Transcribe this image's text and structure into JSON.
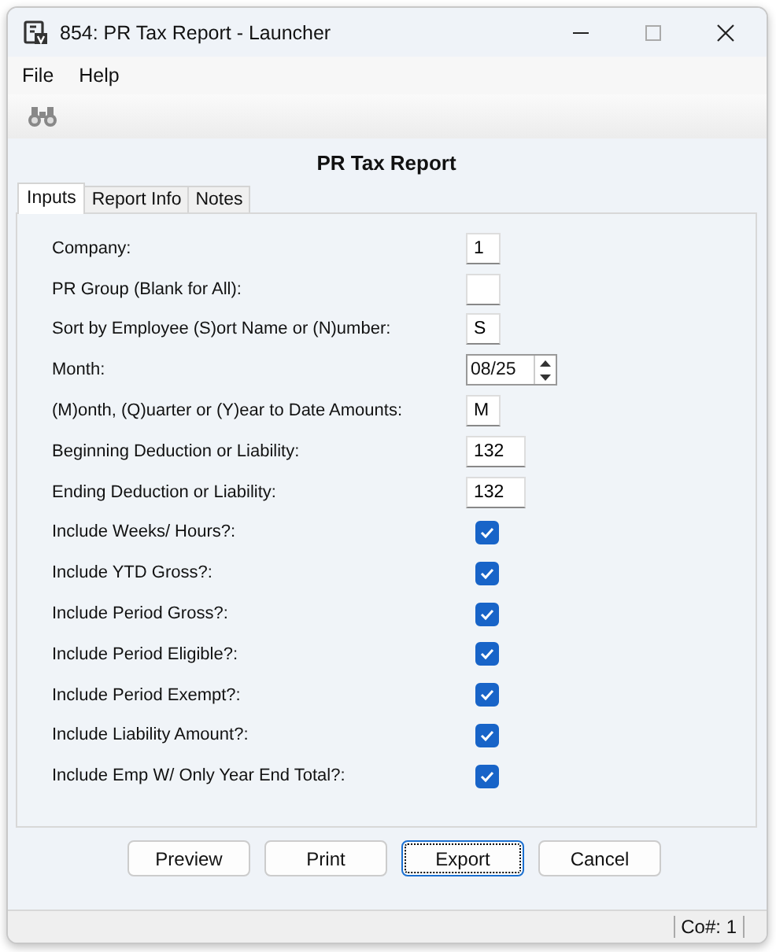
{
  "window": {
    "title": "854: PR Tax Report - Launcher"
  },
  "menu": [
    "File",
    "Help"
  ],
  "heading": "PR Tax Report",
  "tabs": [
    {
      "label": "Inputs",
      "selected": true
    },
    {
      "label": "Report Info",
      "selected": false
    },
    {
      "label": "Notes",
      "selected": false
    }
  ],
  "fields": [
    {
      "kind": "text",
      "label": "Company:",
      "value": "1"
    },
    {
      "kind": "text",
      "label": "PR Group (Blank for All):"
    },
    {
      "kind": "text",
      "label": "Sort by Employee (S)ort Name or (N)umber:",
      "value": "S"
    },
    {
      "kind": "spinner",
      "label": "Month:",
      "value": "08/25"
    },
    {
      "kind": "text",
      "label": "(M)onth, (Q)uarter or (Y)ear to Date Amounts:",
      "value": "M"
    },
    {
      "kind": "text",
      "label": "Beginning Deduction or Liability:",
      "value": "132"
    },
    {
      "kind": "text",
      "label": "Ending Deduction or Liability:",
      "value": "132"
    },
    {
      "kind": "checkbox",
      "label": "Include Weeks/ Hours?:",
      "checked": true
    },
    {
      "kind": "checkbox",
      "label": "Include YTD Gross?:",
      "checked": true
    },
    {
      "kind": "checkbox",
      "label": "Include Period Gross?:",
      "checked": true
    },
    {
      "kind": "checkbox",
      "label": "Include Period Eligible?:",
      "checked": true
    },
    {
      "kind": "checkbox",
      "label": "Include Period Exempt?:",
      "checked": true
    },
    {
      "kind": "checkbox",
      "label": "Include Liability Amount?:",
      "checked": true
    },
    {
      "kind": "checkbox",
      "label": "Include Emp W/ Only Year End Total?:",
      "checked": true
    }
  ],
  "buttons": [
    {
      "label": "Preview",
      "focused": false
    },
    {
      "label": "Print",
      "focused": false
    },
    {
      "label": "Export",
      "focused": true
    },
    {
      "label": "Cancel",
      "focused": false
    }
  ],
  "status_bar": {
    "company": "Co#: 1"
  }
}
